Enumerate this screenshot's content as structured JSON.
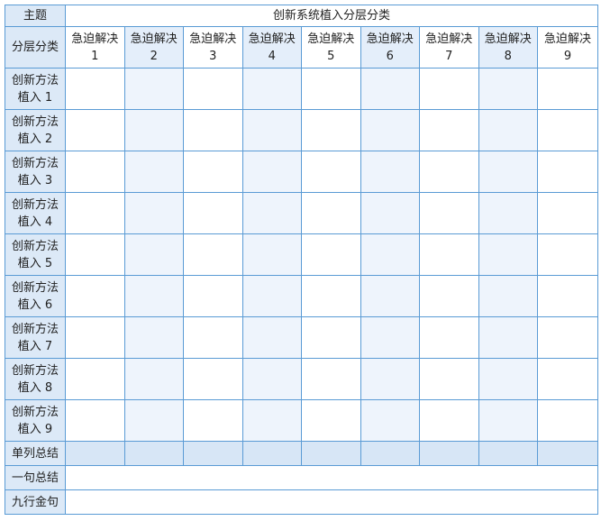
{
  "theme": {
    "label": "主题",
    "value": "创新系统植入分层分类"
  },
  "header": {
    "label": "分层分类",
    "columns": [
      {
        "line1": "急迫解决",
        "line2": "1"
      },
      {
        "line1": "急迫解决",
        "line2": "2"
      },
      {
        "line1": "急迫解决",
        "line2": "3"
      },
      {
        "line1": "急迫解决",
        "line2": "4"
      },
      {
        "line1": "急迫解决",
        "line2": "5"
      },
      {
        "line1": "急迫解决",
        "line2": "6"
      },
      {
        "line1": "急迫解决",
        "line2": "7"
      },
      {
        "line1": "急迫解决",
        "line2": "8"
      },
      {
        "line1": "急迫解决",
        "line2": "9"
      }
    ]
  },
  "rows": [
    {
      "line1": "创新方法",
      "line2": "植入 1"
    },
    {
      "line1": "创新方法",
      "line2": "植入 2"
    },
    {
      "line1": "创新方法",
      "line2": "植入 3"
    },
    {
      "line1": "创新方法",
      "line2": "植入 4"
    },
    {
      "line1": "创新方法",
      "line2": "植入 5"
    },
    {
      "line1": "创新方法",
      "line2": "植入 6"
    },
    {
      "line1": "创新方法",
      "line2": "植入 7"
    },
    {
      "line1": "创新方法",
      "line2": "植入 8"
    },
    {
      "line1": "创新方法",
      "line2": "植入 9"
    }
  ],
  "summary": {
    "column_summary_label": "单列总结",
    "one_sentence_label": "一句总结",
    "nine_lines_label": "九行金句"
  },
  "colors": {
    "border": "#5a9bd5",
    "label_bg": "#dce9f7",
    "alt_column_bg": "#eef4fc",
    "summary_bg": "#d7e6f6"
  }
}
